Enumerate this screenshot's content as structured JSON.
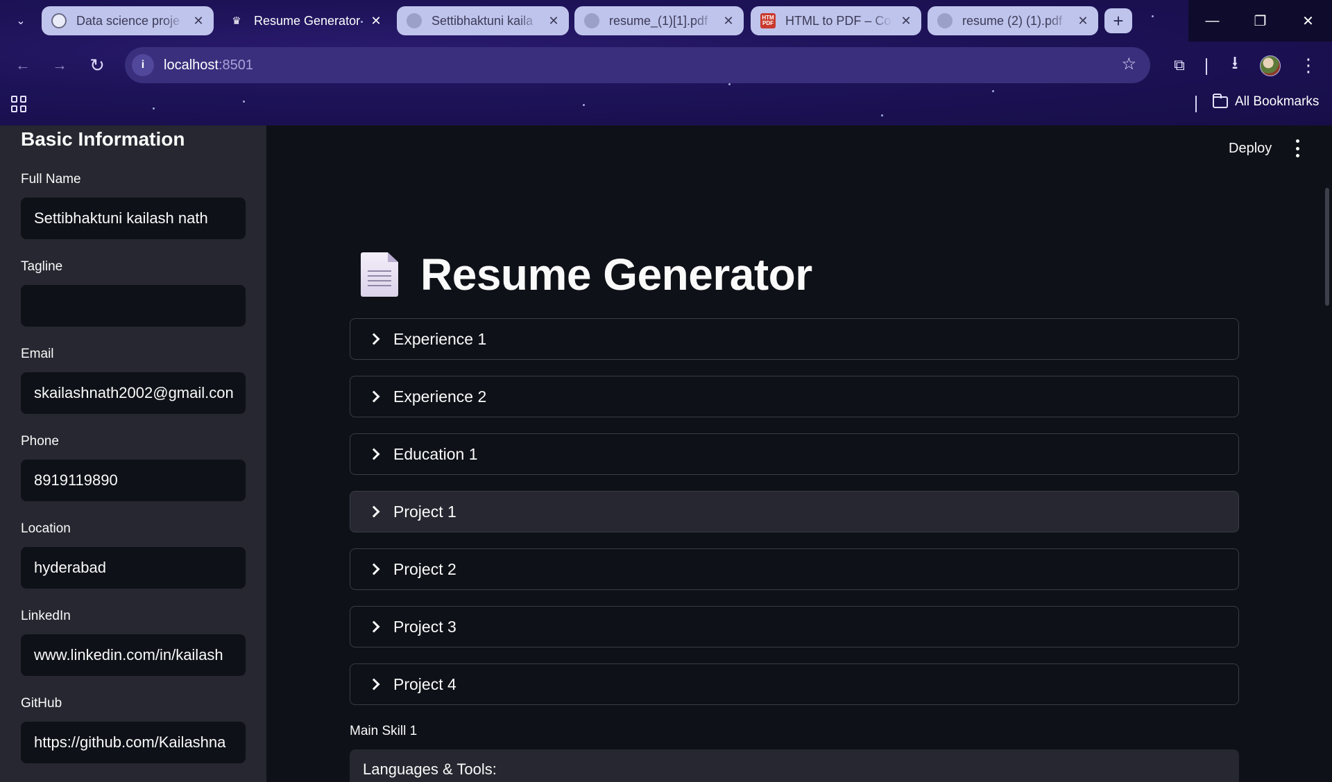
{
  "browser": {
    "tabs": [
      {
        "label": "Data science proje",
        "icon": "chatgpt-favicon",
        "active": false
      },
      {
        "label": "Resume Generator",
        "icon": "streamlit-crown-favicon",
        "active": true
      },
      {
        "label": "Settibhaktuni kaila",
        "icon": "globe-favicon",
        "active": false
      },
      {
        "label": "resume_(1)[1].pdf",
        "icon": "globe-favicon",
        "active": false
      },
      {
        "label": "HTML to PDF – Co",
        "icon": "html-pdf-favicon",
        "active": false
      },
      {
        "label": "resume (2) (1).pdf",
        "icon": "globe-favicon",
        "active": false
      }
    ],
    "favicon_text": {
      "html_pdf": "HTM PDF"
    },
    "url_host": "localhost",
    "url_port": ":8501",
    "bookmarks_label": "All Bookmarks",
    "icons": {
      "close": "✕",
      "plus": "+",
      "back": "←",
      "forward": "→",
      "reload": "↻",
      "star": "☆",
      "download": "⭳",
      "extensions": "⧉",
      "menu": "⋮",
      "tab_search": "⌄",
      "minimize": "—",
      "restore": "❐",
      "info": "i"
    },
    "theme_colors": {
      "chrome": "#1d1257",
      "tab": "#bfc4ec",
      "omnibox": "#3a2f7d"
    }
  },
  "sidebar": {
    "heading": "Basic Information",
    "fields": [
      {
        "label": "Full Name",
        "value": "Settibhaktuni kailash nath"
      },
      {
        "label": "Tagline",
        "value": ""
      },
      {
        "label": "Email",
        "value": "skailashnath2002@gmail.con"
      },
      {
        "label": "Phone",
        "value": "8919119890"
      },
      {
        "label": "Location",
        "value": "hyderabad"
      },
      {
        "label": "LinkedIn",
        "value": "www.linkedin.com/in/kailash"
      },
      {
        "label": "GitHub",
        "value": "https://github.com/Kailashna"
      }
    ]
  },
  "header": {
    "deploy_label": "Deploy"
  },
  "main": {
    "title": "Resume Generator",
    "title_icon": "page-facing-up-emoji",
    "expanders": [
      {
        "label": "Experience 1",
        "hovered": false
      },
      {
        "label": "Experience 2",
        "hovered": false
      },
      {
        "label": "Education 1",
        "hovered": false
      },
      {
        "label": "Project 1",
        "hovered": true
      },
      {
        "label": "Project 2",
        "hovered": false
      },
      {
        "label": "Project 3",
        "hovered": false
      },
      {
        "label": "Project 4",
        "hovered": false
      }
    ],
    "skill_label": "Main Skill 1",
    "skill_value": "Languages & Tools:"
  },
  "colors": {
    "app_bg": "#0e1117",
    "sidebar_bg": "#262730",
    "text": "#fafafa",
    "border": "#3a3c47"
  }
}
